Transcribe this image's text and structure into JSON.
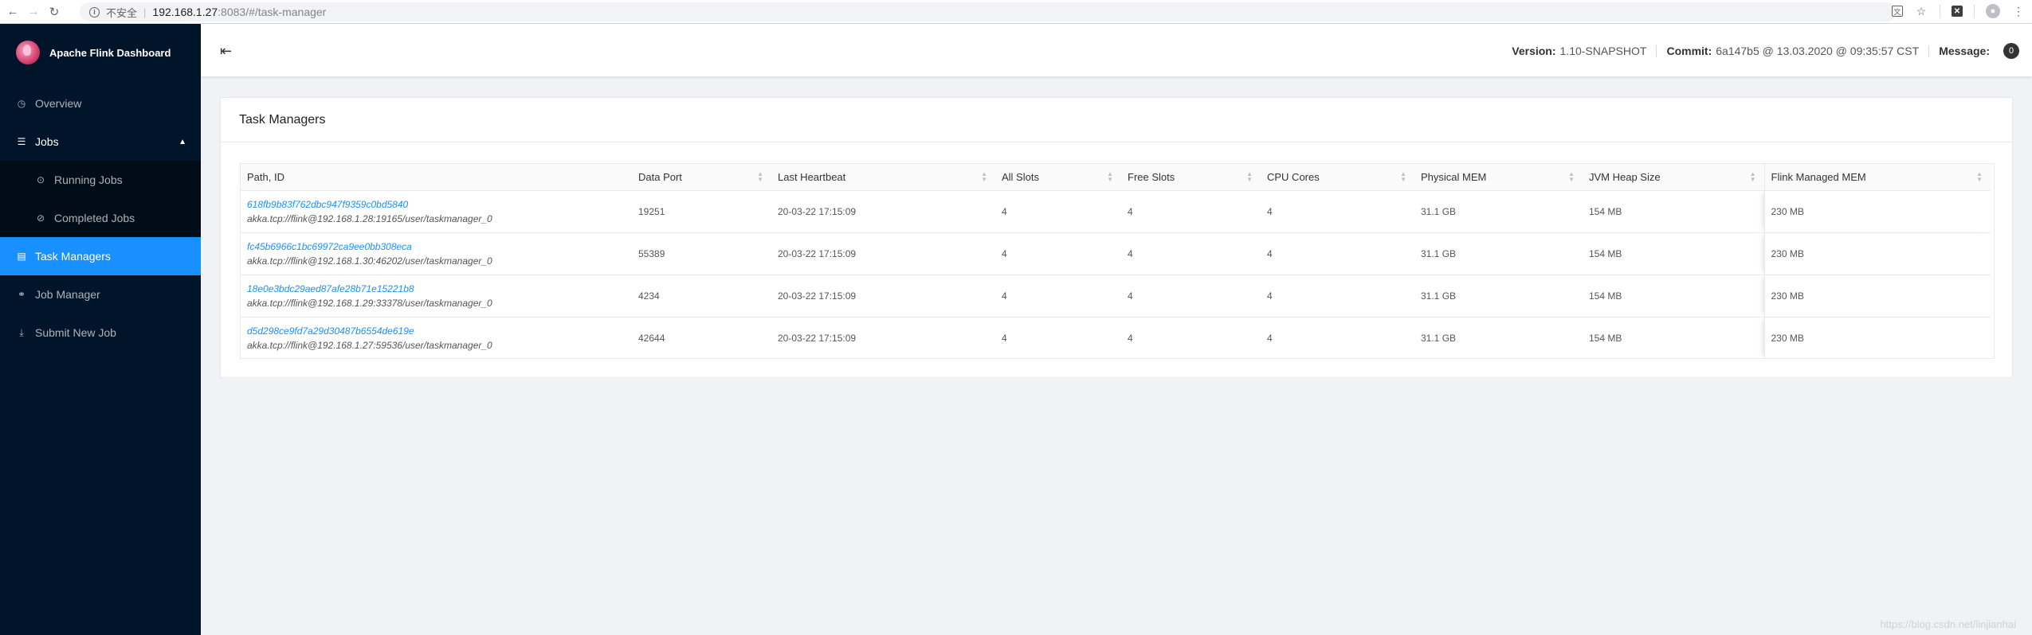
{
  "browser": {
    "insecure_label": "不安全",
    "url_host": "192.168.1.27",
    "url_rest": ":8083/#/task-manager"
  },
  "sidebar": {
    "title": "Apache Flink Dashboard",
    "items": [
      {
        "label": "Overview",
        "icon": "dashboard-icon"
      },
      {
        "label": "Jobs",
        "icon": "list-icon"
      },
      {
        "label": "Running Jobs",
        "icon": "play-circle-icon"
      },
      {
        "label": "Completed Jobs",
        "icon": "check-circle-icon"
      },
      {
        "label": "Task Managers",
        "icon": "schedule-icon"
      },
      {
        "label": "Job Manager",
        "icon": "cluster-icon"
      },
      {
        "label": "Submit New Job",
        "icon": "upload-icon"
      }
    ]
  },
  "header": {
    "version_label": "Version:",
    "version_value": "1.10-SNAPSHOT",
    "commit_label": "Commit:",
    "commit_value": "6a147b5 @ 13.03.2020 @ 09:35:57 CST",
    "message_label": "Message:",
    "message_count": "0"
  },
  "main": {
    "title": "Task Managers",
    "columns": [
      "Path, ID",
      "Data Port",
      "Last Heartbeat",
      "All Slots",
      "Free Slots",
      "CPU Cores",
      "Physical MEM",
      "JVM Heap Size",
      "Flink Managed MEM"
    ],
    "rows": [
      {
        "id": "618fb9b83f762dbc947f9359c0bd5840",
        "path": "akka.tcp://flink@192.168.1.28:19165/user/taskmanager_0",
        "port": "19251",
        "heartbeat": "20-03-22 17:15:09",
        "all_slots": "4",
        "free_slots": "4",
        "cpu": "4",
        "physical": "31.1 GB",
        "heap": "154 MB",
        "managed": "230 MB"
      },
      {
        "id": "fc45b6966c1bc69972ca9ee0bb308eca",
        "path": "akka.tcp://flink@192.168.1.30:46202/user/taskmanager_0",
        "port": "55389",
        "heartbeat": "20-03-22 17:15:09",
        "all_slots": "4",
        "free_slots": "4",
        "cpu": "4",
        "physical": "31.1 GB",
        "heap": "154 MB",
        "managed": "230 MB"
      },
      {
        "id": "18e0e3bdc29aed87afe28b71e15221b8",
        "path": "akka.tcp://flink@192.168.1.29:33378/user/taskmanager_0",
        "port": "4234",
        "heartbeat": "20-03-22 17:15:09",
        "all_slots": "4",
        "free_slots": "4",
        "cpu": "4",
        "physical": "31.1 GB",
        "heap": "154 MB",
        "managed": "230 MB"
      },
      {
        "id": "d5d298ce9fd7a29d30487b6554de619e",
        "path": "akka.tcp://flink@192.168.1.27:59536/user/taskmanager_0",
        "port": "42644",
        "heartbeat": "20-03-22 17:15:09",
        "all_slots": "4",
        "free_slots": "4",
        "cpu": "4",
        "physical": "31.1 GB",
        "heap": "154 MB",
        "managed": "230 MB"
      }
    ]
  },
  "watermark": "https://blog.csdn.net/linjianhai"
}
